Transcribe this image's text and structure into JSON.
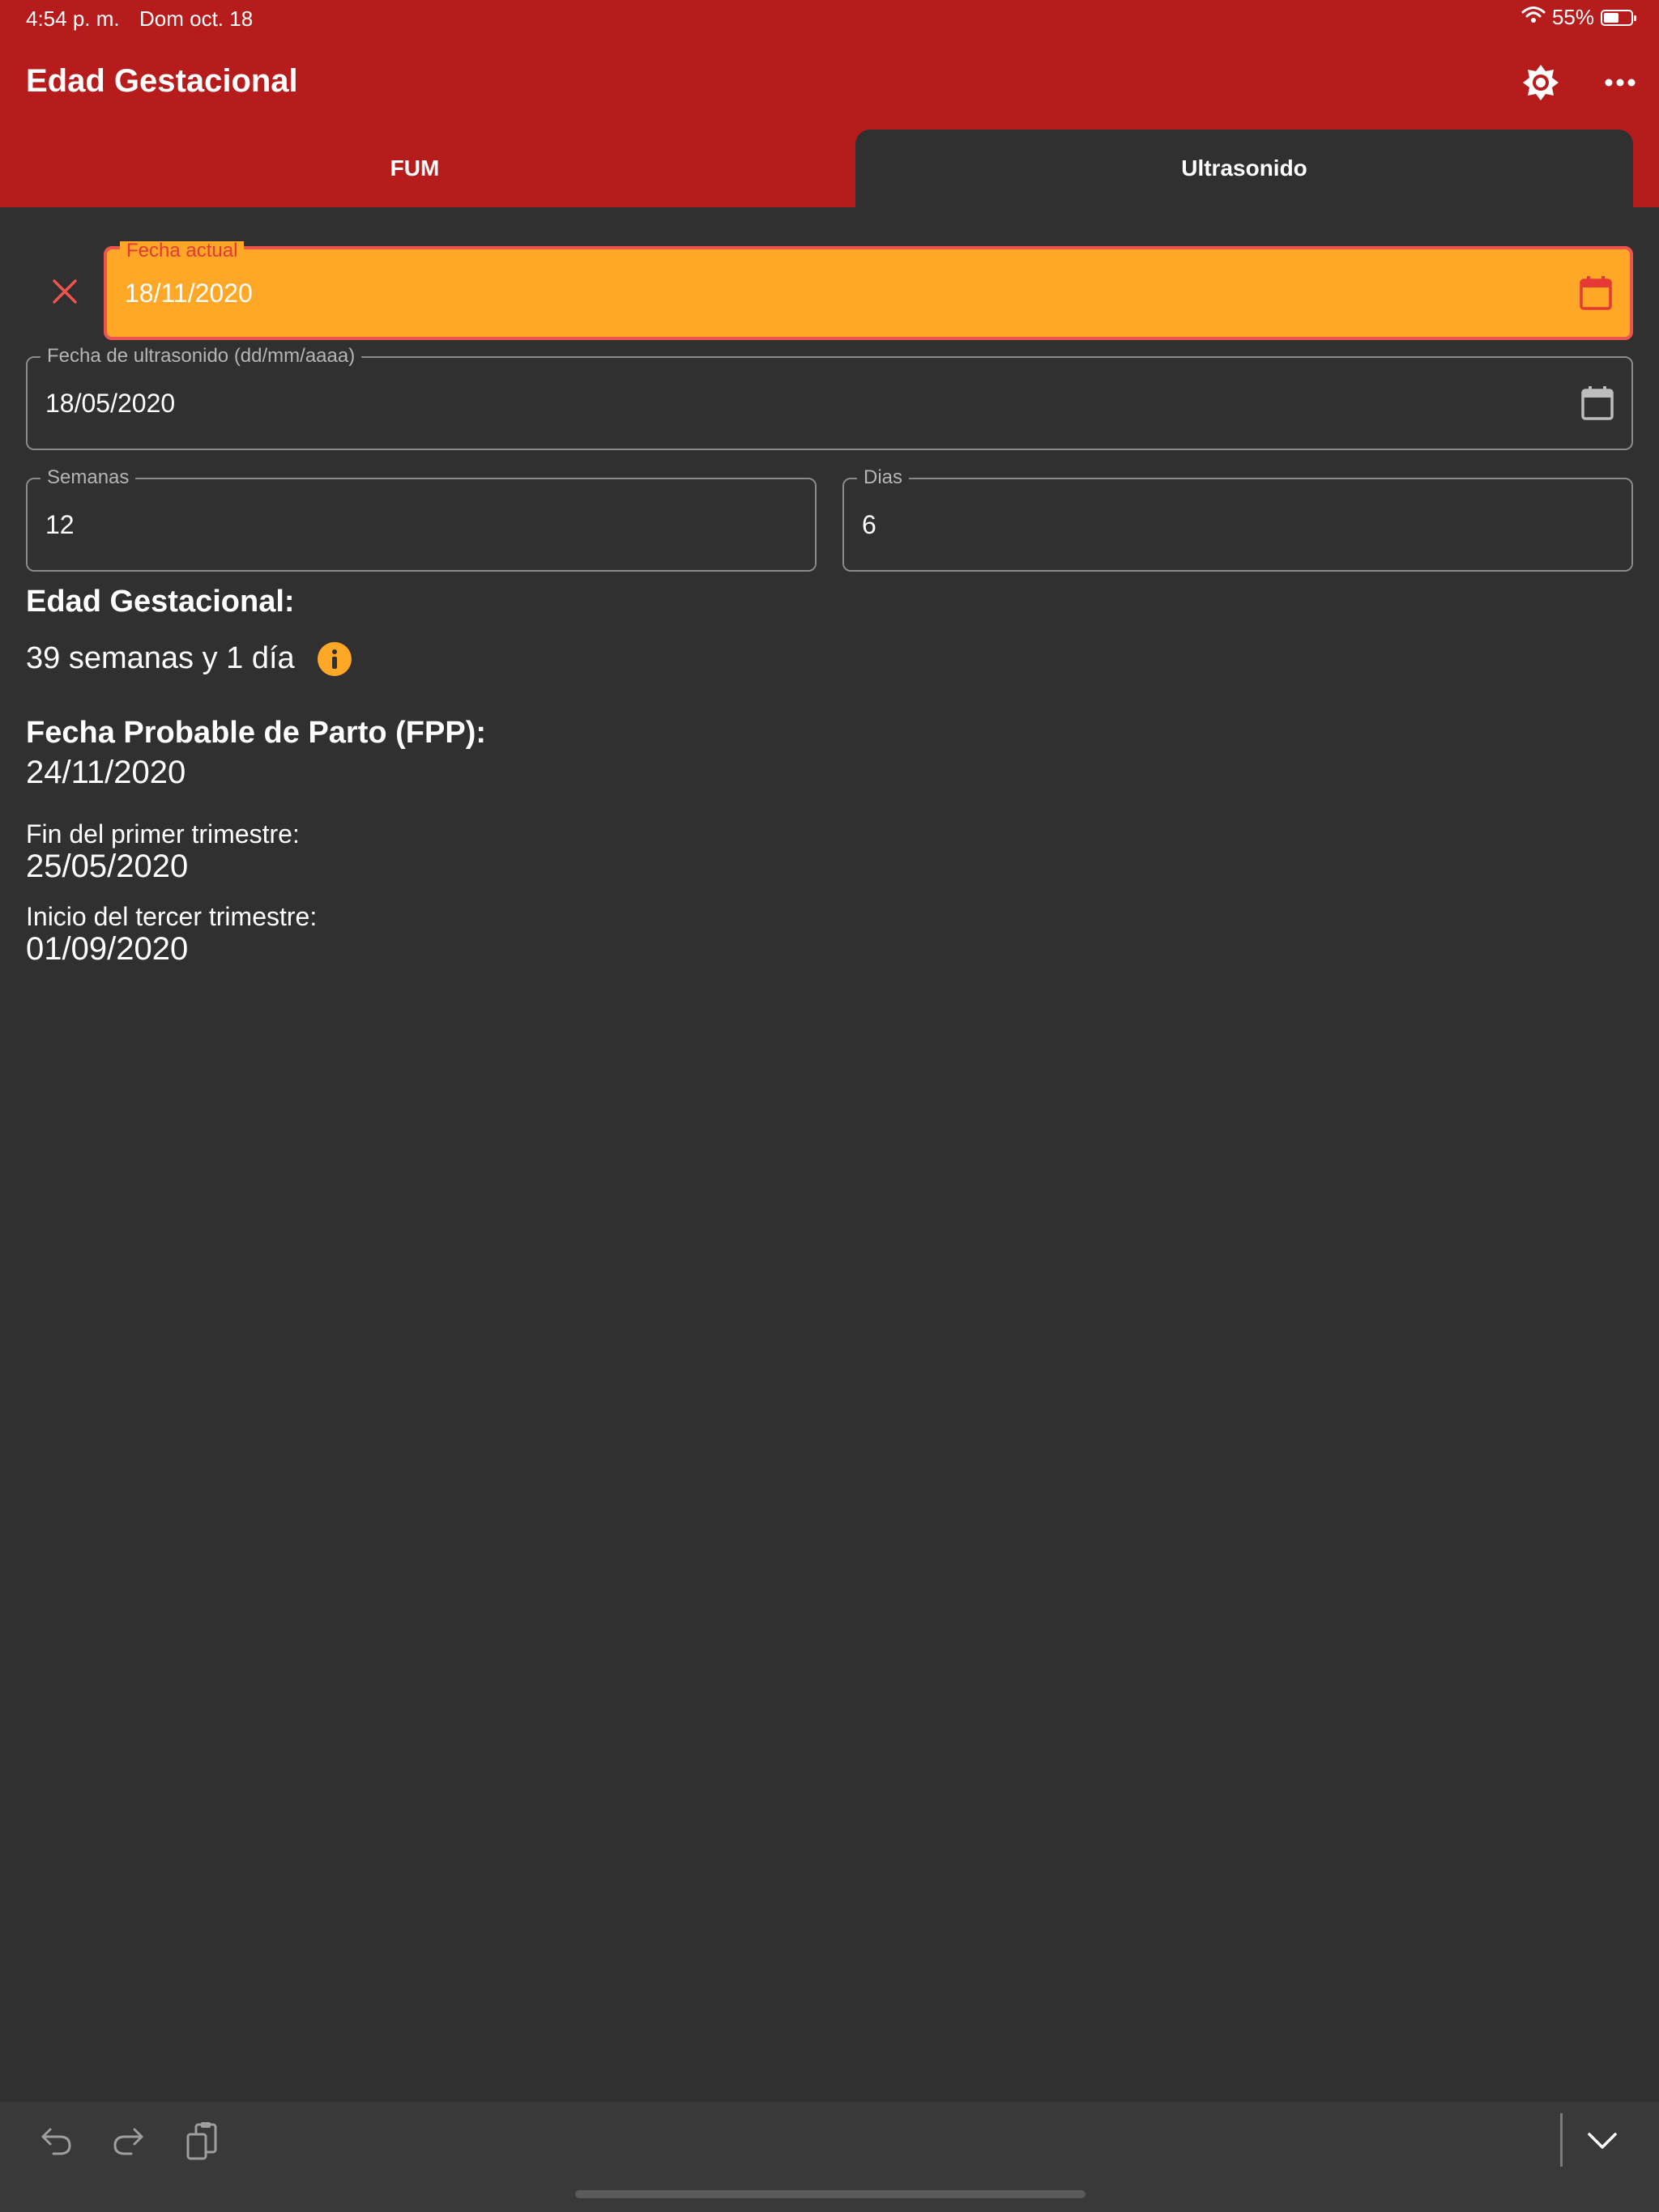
{
  "status_bar": {
    "time": "4:54 p. m.",
    "date": "Dom oct. 18",
    "battery_percent": "55%",
    "battery_level": 0.55
  },
  "header": {
    "title": "Edad Gestacional",
    "brightness_icon": "brightness-icon",
    "more_icon": "more-horizontal-icon",
    "background_color": "#b71c1c"
  },
  "tabs": [
    {
      "label": "FUM",
      "selected": false
    },
    {
      "label": "Ultrasonido",
      "selected": true
    }
  ],
  "form": {
    "fecha_actual": {
      "label": "Fecha actual",
      "value": "18/11/2020",
      "highlight_color": "#ffa726",
      "border_color": "#ef5350"
    },
    "fecha_ultrasonido": {
      "label": "Fecha de ultrasonido (dd/mm/aaaa)",
      "value": "18/05/2020"
    },
    "semanas": {
      "label": "Semanas",
      "value": "12"
    },
    "dias": {
      "label": "Dias",
      "value": "6"
    }
  },
  "results": {
    "edad_gestacional_heading": "Edad Gestacional:",
    "edad_gestacional_value": "39 semanas y 1 día",
    "fpp_heading": "Fecha Probable de Parto (FPP):",
    "fpp_value": "24/11/2020",
    "fin_primer_trimestre_label": "Fin del primer trimestre:",
    "fin_primer_trimestre_value": "25/05/2020",
    "inicio_tercer_trimestre_label": "Inicio del tercer trimestre:",
    "inicio_tercer_trimestre_value": "01/09/2020"
  },
  "toolbar": {
    "undo_icon": "undo-icon",
    "redo_icon": "redo-icon",
    "paste_icon": "paste-icon",
    "collapse_icon": "chevron-down-icon"
  }
}
